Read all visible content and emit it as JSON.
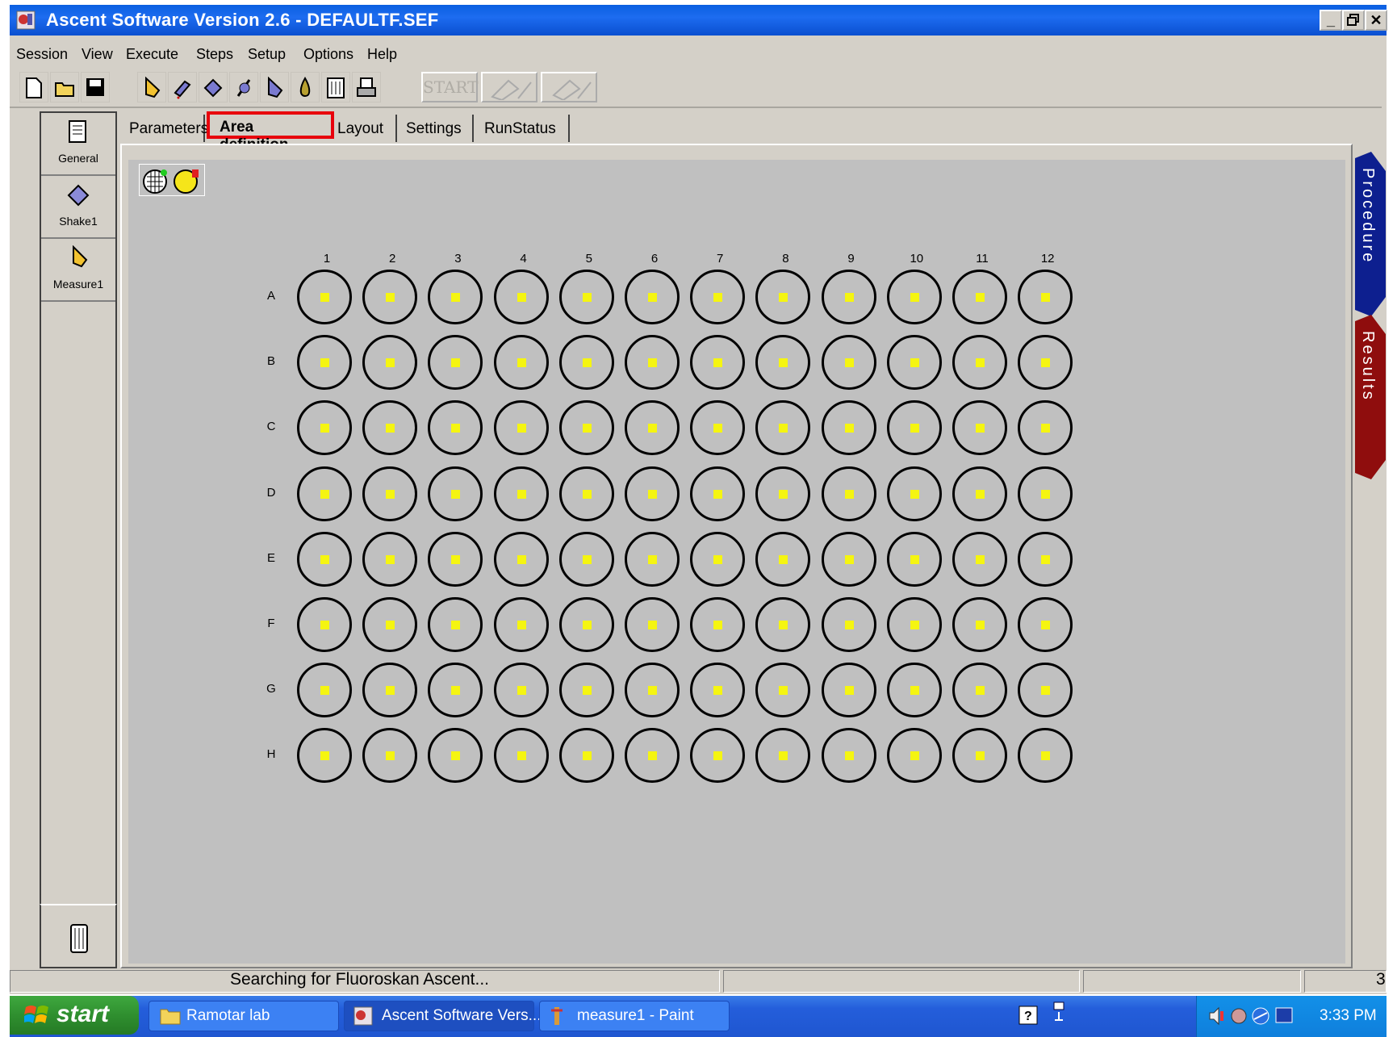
{
  "window": {
    "title": "Ascent Software Version 2.6 - DEFAULTF.SEF",
    "controls": [
      "_",
      "̅",
      "✕"
    ]
  },
  "menu": [
    "Session",
    "View",
    "Execute",
    "Steps",
    "Setup",
    "Options",
    "Help"
  ],
  "toolbar": {
    "start_label": "START",
    "icons": [
      "new-file-icon",
      "open-folder-icon",
      "save-icon",
      "measure-step-icon",
      "dispense-step-icon",
      "shake-step-icon",
      "incubate-step-icon",
      "kinetic-step-icon",
      "wash-step-icon",
      "calculate-icon",
      "print-icon",
      "start-icon",
      "abort-icon",
      "stop-icon"
    ]
  },
  "steps": [
    {
      "label": "General",
      "icon": "general-icon"
    },
    {
      "label": "Shake1",
      "icon": "shake-icon"
    },
    {
      "label": "Measure1",
      "icon": "measure-icon"
    }
  ],
  "tabs": [
    "Parameters",
    "Area definition",
    "Layout",
    "Settings",
    "RunStatus"
  ],
  "active_tab": "Area definition",
  "plate": {
    "columns": [
      "1",
      "2",
      "3",
      "4",
      "5",
      "6",
      "7",
      "8",
      "9",
      "10",
      "11",
      "12"
    ],
    "rows": [
      "A",
      "B",
      "C",
      "D",
      "E",
      "F",
      "G",
      "H"
    ],
    "well_spot_color": "#f5f511",
    "background": "#c0c0c0"
  },
  "side_tabs": [
    {
      "label": "Procedure",
      "color": "#0d1f8f"
    },
    {
      "label": "Results",
      "color": "#8f0d0d"
    }
  ],
  "status": {
    "message": "Searching for Fluoroskan Ascent...",
    "right_value": "3"
  },
  "taskbar": {
    "start_label": "start",
    "tasks": [
      {
        "label": "Ramotar lab",
        "icon": "folder-icon"
      },
      {
        "label": "Ascent Software Vers...",
        "icon": "ascent-app-icon"
      },
      {
        "label": "measure1 - Paint",
        "icon": "paint-icon"
      }
    ],
    "clock": "3:33 PM"
  }
}
